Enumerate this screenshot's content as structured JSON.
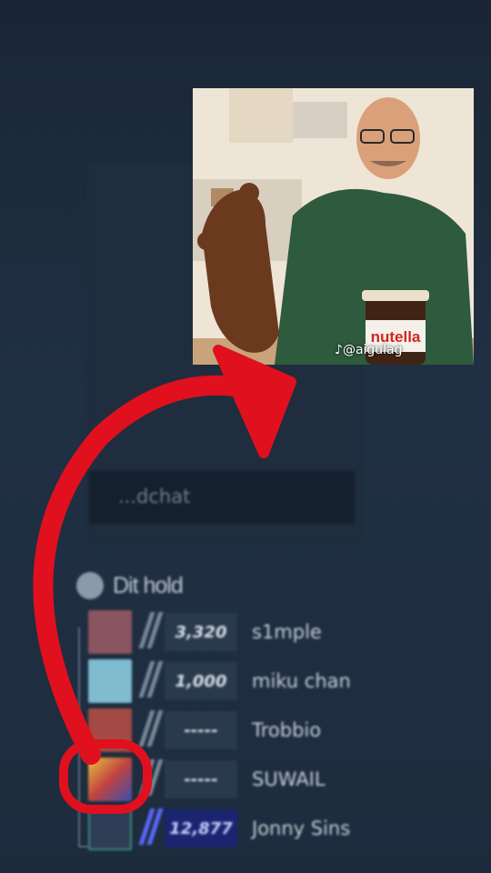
{
  "chat": {
    "placeholder_text": "...dchat"
  },
  "team": {
    "name": "Dit hold"
  },
  "players": [
    {
      "elo": "3,320",
      "name": "s1mple",
      "avatar_color": "#8a5560"
    },
    {
      "elo": "1,000",
      "name": "miku chan",
      "avatar_color": "#7fbcd0"
    },
    {
      "elo": "-----",
      "name": "Trobbio",
      "avatar_color": "#a34a45"
    },
    {
      "elo": "-----",
      "name": "SUWAIL",
      "avatar_color": "#d59a3c"
    },
    {
      "elo": "12,877",
      "name": "Jonny Sins",
      "avatar_color": "#2e3d55"
    }
  ],
  "meme": {
    "watermark": "@aigulag",
    "jar_label": "nutella"
  },
  "colors": {
    "arrow": "#e0101e",
    "background": "#1f2d3e",
    "elo_highlight": "#1b2470"
  }
}
